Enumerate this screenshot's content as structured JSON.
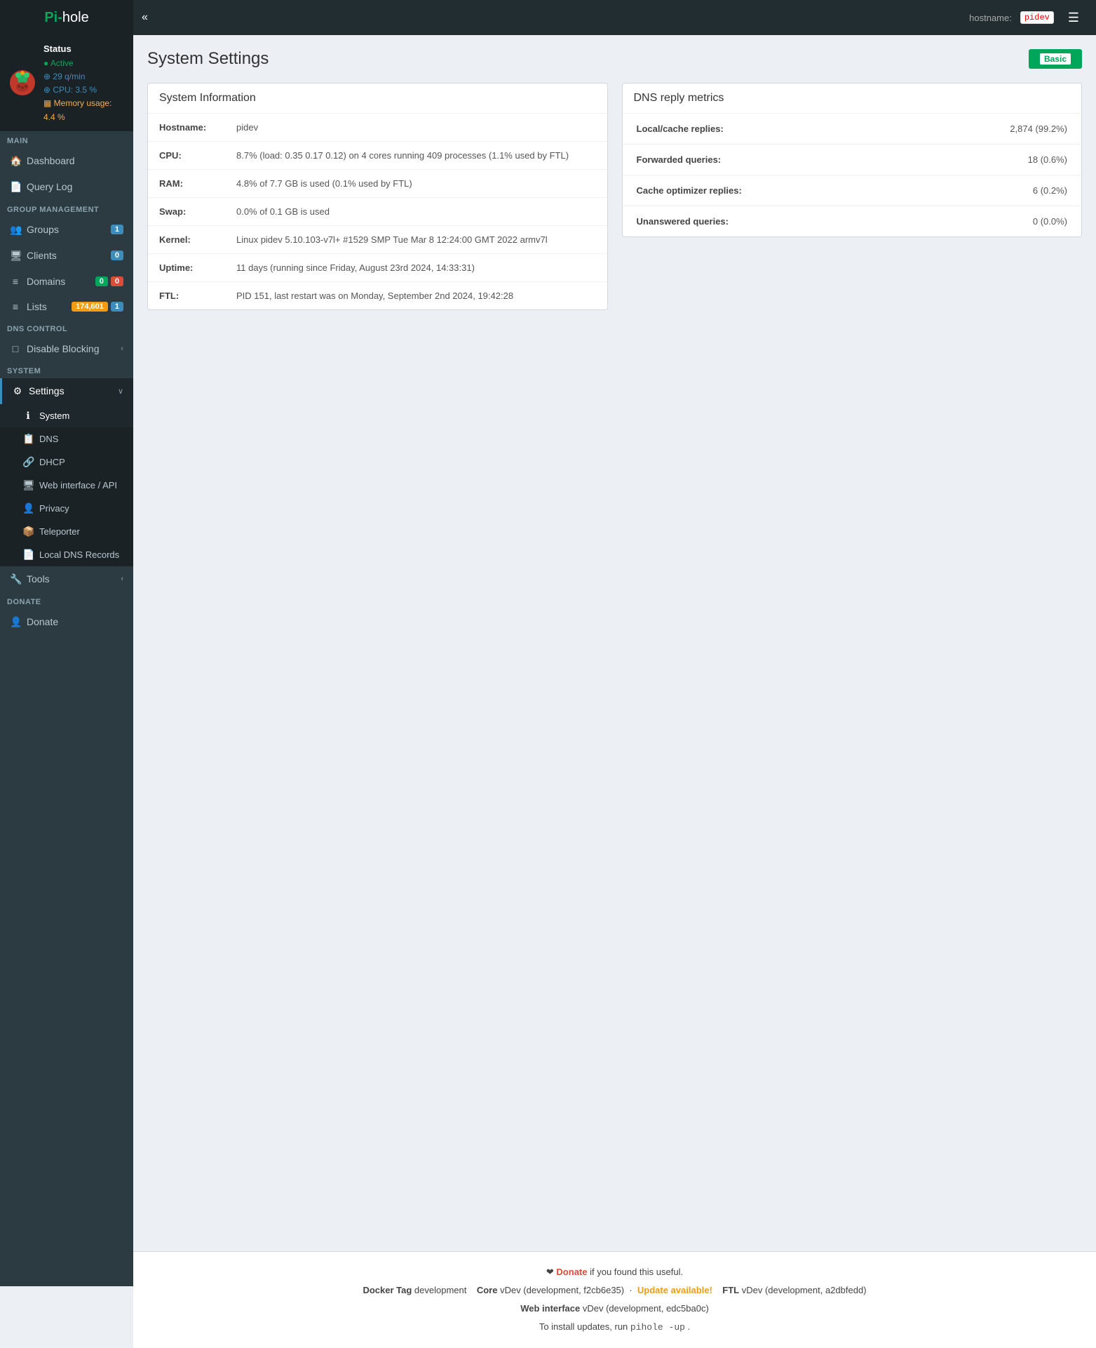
{
  "navbar": {
    "brand_pre": "Pi-",
    "brand_post": "hole",
    "toggle_label": "«",
    "hostname_label": "hostname:",
    "hostname_value": "pidev",
    "menu_icon": "☰"
  },
  "sidebar": {
    "status": {
      "title": "Status",
      "active": "Active",
      "queries": "29 q/min",
      "cpu": "CPU: 3.5 %",
      "memory": "Memory usage: 4.4 %"
    },
    "sections": [
      {
        "label": "MAIN",
        "items": [
          {
            "id": "dashboard",
            "icon": "🏠",
            "label": "Dashboard",
            "badge": null,
            "active": false
          },
          {
            "id": "query-log",
            "icon": "📄",
            "label": "Query Log",
            "badge": null,
            "active": false
          }
        ]
      },
      {
        "label": "GROUP MANAGEMENT",
        "items": [
          {
            "id": "groups",
            "icon": "👥",
            "label": "Groups",
            "badge": "1",
            "badge_color": "blue",
            "active": false
          },
          {
            "id": "clients",
            "icon": "🖥",
            "label": "Clients",
            "badge": "0",
            "badge_color": "blue",
            "active": false
          },
          {
            "id": "domains",
            "icon": "☰",
            "label": "Domains",
            "badge_multi": [
              "0",
              "0"
            ],
            "badge_colors": [
              "green",
              "red"
            ],
            "active": false
          },
          {
            "id": "lists",
            "icon": "☰",
            "label": "Lists",
            "badge_multi": [
              "174,601",
              "1"
            ],
            "badge_colors": [
              "orange",
              "blue"
            ],
            "active": false
          }
        ]
      },
      {
        "label": "DNS CONTROL",
        "items": [
          {
            "id": "disable-blocking",
            "icon": "□",
            "label": "Disable Blocking",
            "chevron": "‹",
            "active": false
          }
        ]
      },
      {
        "label": "SYSTEM",
        "items": [
          {
            "id": "settings",
            "icon": "⚙",
            "label": "Settings",
            "chevron": "∨",
            "active": true,
            "expanded": true
          }
        ]
      }
    ],
    "settings_submenu": [
      {
        "id": "system",
        "icon": "ℹ",
        "label": "System",
        "active": true
      },
      {
        "id": "dns",
        "icon": "📋",
        "label": "DNS",
        "active": false
      },
      {
        "id": "dhcp",
        "icon": "🔗",
        "label": "DHCP",
        "active": false
      },
      {
        "id": "web-interface",
        "icon": "🖥",
        "label": "Web interface / API",
        "active": false
      },
      {
        "id": "privacy",
        "icon": "👤",
        "label": "Privacy",
        "active": false
      },
      {
        "id": "teleporter",
        "icon": "📦",
        "label": "Teleporter",
        "active": false
      },
      {
        "id": "local-dns",
        "icon": "📄",
        "label": "Local DNS Records",
        "active": false
      }
    ],
    "tools_section": {
      "label": "SYSTEM",
      "item": {
        "id": "tools",
        "icon": "🔧",
        "label": "Tools",
        "chevron": "‹"
      }
    },
    "donate_section": {
      "label": "DONATE",
      "item": {
        "id": "donate",
        "icon": "👤",
        "label": "Donate"
      }
    }
  },
  "page": {
    "title": "System Settings",
    "basic_btn_label": "Basic"
  },
  "system_info": {
    "card_title": "System Information",
    "rows": [
      {
        "label": "Hostname:",
        "value": "pidev"
      },
      {
        "label": "CPU:",
        "value": "8.7% (load: 0.35 0.17 0.12) on 4 cores running 409 processes (1.1% used by FTL)"
      },
      {
        "label": "RAM:",
        "value": "4.8% of 7.7 GB is used (0.1% used by FTL)"
      },
      {
        "label": "Swap:",
        "value": "0.0% of 0.1 GB is used"
      },
      {
        "label": "Kernel:",
        "value": "Linux pidev 5.10.103-v7l+ #1529 SMP Tue Mar 8 12:24:00 GMT 2022 armv7l"
      },
      {
        "label": "Uptime:",
        "value": "11 days (running since Friday, August 23rd 2024, 14:33:31)"
      },
      {
        "label": "FTL:",
        "value": "PID 151, last restart was on Monday, September 2nd 2024, 19:42:28"
      }
    ]
  },
  "dns_metrics": {
    "card_title": "DNS reply metrics",
    "rows": [
      {
        "label": "Local/cache replies:",
        "value": "2,874 (99.2%)"
      },
      {
        "label": "Forwarded queries:",
        "value": "18 (0.6%)"
      },
      {
        "label": "Cache optimizer replies:",
        "value": "6 (0.2%)"
      },
      {
        "label": "Unanswered queries:",
        "value": "0 (0.0%)"
      }
    ]
  },
  "footer": {
    "donate_text": "Donate",
    "donate_suffix": " if you found this useful.",
    "docker_tag_label": "Docker Tag",
    "docker_tag_value": "development",
    "core_label": "Core",
    "core_value": "vDev (development, f2cb6e35)",
    "update_label": "Update available!",
    "ftl_label": "FTL",
    "ftl_value": "vDev (development, a2dbfedd)",
    "web_label": "Web interface",
    "web_value": "vDev (development, edc5ba0c)",
    "install_prefix": "To install updates, run",
    "install_cmd": "pihole  -up",
    "install_suffix": "."
  }
}
